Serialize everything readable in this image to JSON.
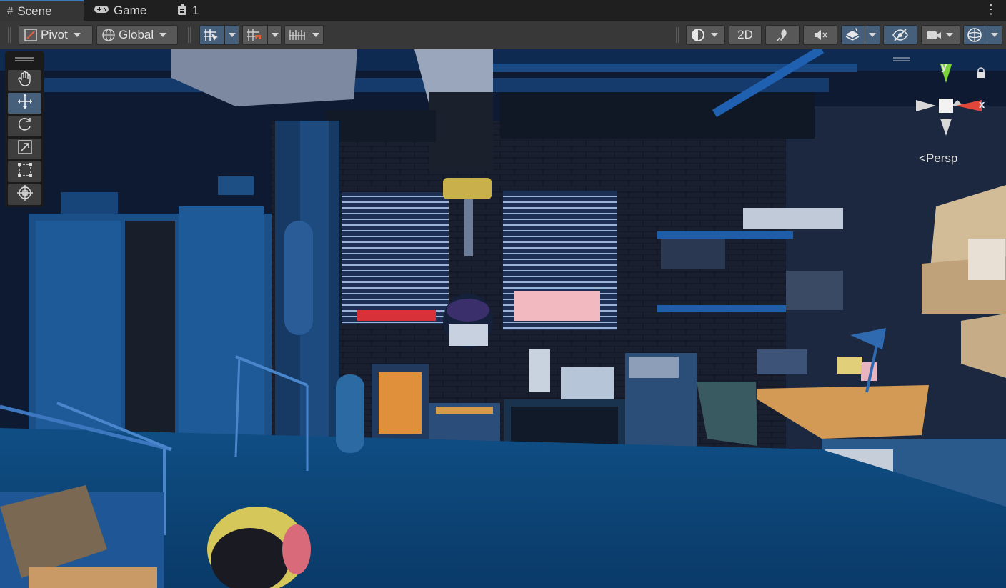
{
  "tabs": [
    {
      "label": "Scene",
      "icon": "grid-icon",
      "active": true
    },
    {
      "label": "Game",
      "icon": "gamepad-icon",
      "active": false
    },
    {
      "label": "1",
      "icon": "hierarchy-icon",
      "active": false
    }
  ],
  "toolbar": {
    "pivot_label": "Pivot",
    "global_label": "Global",
    "mode_2d_label": "2D"
  },
  "scene_view": {
    "projection_label": "Persp",
    "gizmo_axes": {
      "x": "x",
      "y": "y"
    }
  },
  "tools": [
    "hand-tool",
    "move-tool",
    "rotate-tool",
    "scale-tool",
    "rect-tool",
    "transform-tool"
  ],
  "colors": {
    "accent": "#46607c",
    "tab_active_border": "#3a79bb",
    "gizmo_x": "#e0473a",
    "gizmo_y": "#7cd43a"
  }
}
